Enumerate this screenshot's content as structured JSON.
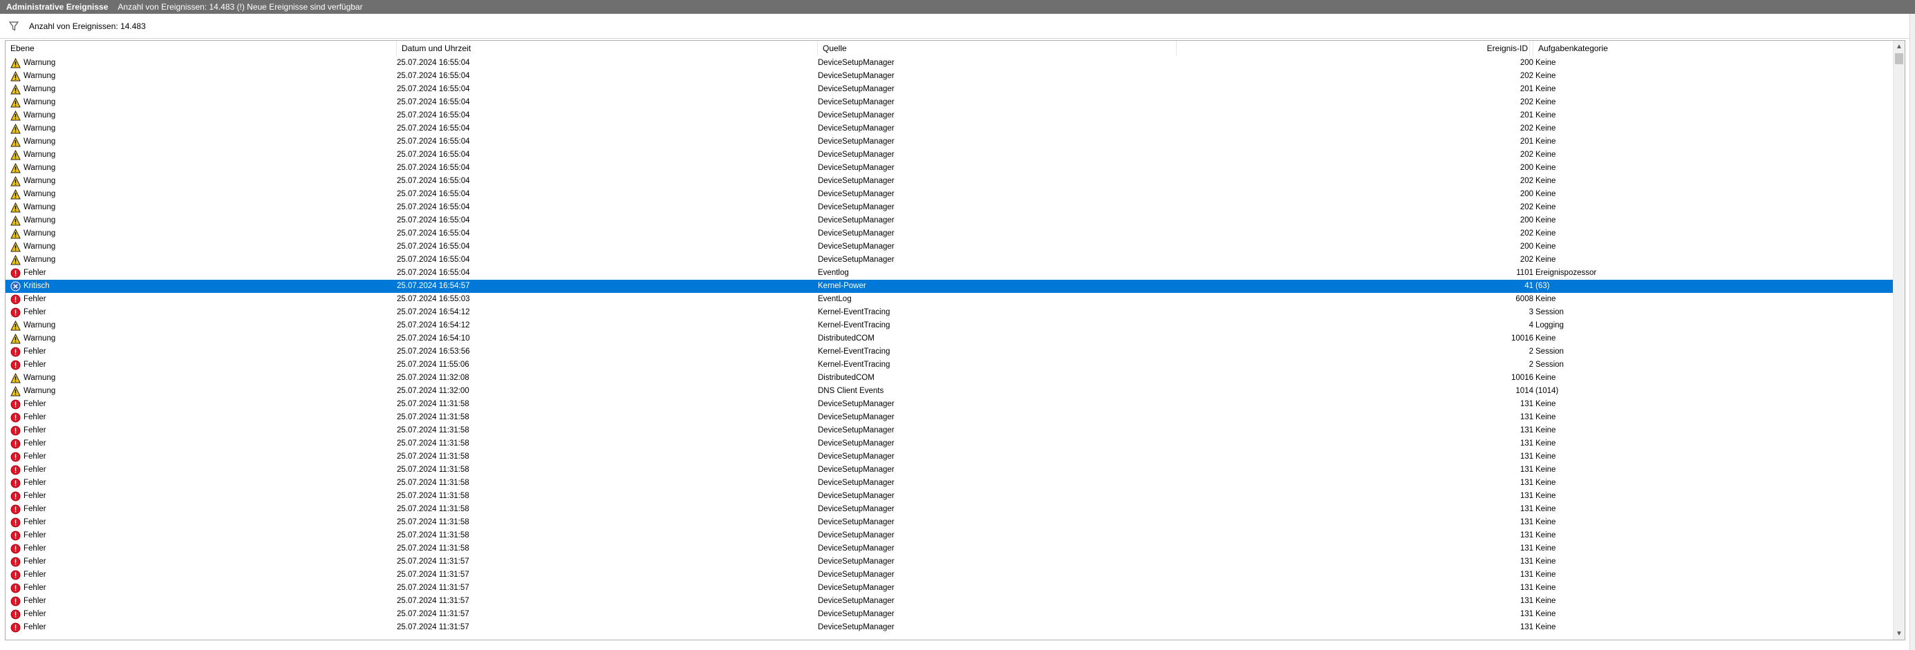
{
  "title_bar": {
    "name": "Administrative Ereignisse",
    "info": "Anzahl von Ereignissen: 14.483 (!) Neue Ereignisse sind verfügbar"
  },
  "filter_bar": {
    "count_text": "Anzahl von Ereignissen: 14.483",
    "icon": "filter-icon"
  },
  "table": {
    "columns": {
      "level": "Ebene",
      "date": "Datum und Uhrzeit",
      "source": "Quelle",
      "event_id": "Ereignis-ID",
      "task_category": "Aufgabenkategorie"
    },
    "rows": [
      {
        "level": "Warnung",
        "date": "25.07.2024 16:55:04",
        "source": "DeviceSetupManager",
        "event_id": "200",
        "task_category": "Keine",
        "icon": "warning-icon"
      },
      {
        "level": "Warnung",
        "date": "25.07.2024 16:55:04",
        "source": "DeviceSetupManager",
        "event_id": "202",
        "task_category": "Keine",
        "icon": "warning-icon"
      },
      {
        "level": "Warnung",
        "date": "25.07.2024 16:55:04",
        "source": "DeviceSetupManager",
        "event_id": "201",
        "task_category": "Keine",
        "icon": "warning-icon"
      },
      {
        "level": "Warnung",
        "date": "25.07.2024 16:55:04",
        "source": "DeviceSetupManager",
        "event_id": "202",
        "task_category": "Keine",
        "icon": "warning-icon"
      },
      {
        "level": "Warnung",
        "date": "25.07.2024 16:55:04",
        "source": "DeviceSetupManager",
        "event_id": "201",
        "task_category": "Keine",
        "icon": "warning-icon"
      },
      {
        "level": "Warnung",
        "date": "25.07.2024 16:55:04",
        "source": "DeviceSetupManager",
        "event_id": "202",
        "task_category": "Keine",
        "icon": "warning-icon"
      },
      {
        "level": "Warnung",
        "date": "25.07.2024 16:55:04",
        "source": "DeviceSetupManager",
        "event_id": "201",
        "task_category": "Keine",
        "icon": "warning-icon"
      },
      {
        "level": "Warnung",
        "date": "25.07.2024 16:55:04",
        "source": "DeviceSetupManager",
        "event_id": "202",
        "task_category": "Keine",
        "icon": "warning-icon"
      },
      {
        "level": "Warnung",
        "date": "25.07.2024 16:55:04",
        "source": "DeviceSetupManager",
        "event_id": "200",
        "task_category": "Keine",
        "icon": "warning-icon"
      },
      {
        "level": "Warnung",
        "date": "25.07.2024 16:55:04",
        "source": "DeviceSetupManager",
        "event_id": "202",
        "task_category": "Keine",
        "icon": "warning-icon"
      },
      {
        "level": "Warnung",
        "date": "25.07.2024 16:55:04",
        "source": "DeviceSetupManager",
        "event_id": "200",
        "task_category": "Keine",
        "icon": "warning-icon"
      },
      {
        "level": "Warnung",
        "date": "25.07.2024 16:55:04",
        "source": "DeviceSetupManager",
        "event_id": "202",
        "task_category": "Keine",
        "icon": "warning-icon"
      },
      {
        "level": "Warnung",
        "date": "25.07.2024 16:55:04",
        "source": "DeviceSetupManager",
        "event_id": "200",
        "task_category": "Keine",
        "icon": "warning-icon"
      },
      {
        "level": "Warnung",
        "date": "25.07.2024 16:55:04",
        "source": "DeviceSetupManager",
        "event_id": "202",
        "task_category": "Keine",
        "icon": "warning-icon"
      },
      {
        "level": "Warnung",
        "date": "25.07.2024 16:55:04",
        "source": "DeviceSetupManager",
        "event_id": "200",
        "task_category": "Keine",
        "icon": "warning-icon"
      },
      {
        "level": "Warnung",
        "date": "25.07.2024 16:55:04",
        "source": "DeviceSetupManager",
        "event_id": "202",
        "task_category": "Keine",
        "icon": "warning-icon"
      },
      {
        "level": "Fehler",
        "date": "25.07.2024 16:55:04",
        "source": "Eventlog",
        "event_id": "1101",
        "task_category": "Ereignispozessor",
        "icon": "error-icon"
      },
      {
        "level": "Kritisch",
        "date": "25.07.2024 16:54:57",
        "source": "Kernel-Power",
        "event_id": "41",
        "task_category": "(63)",
        "icon": "critical-icon",
        "selected": true
      },
      {
        "level": "Fehler",
        "date": "25.07.2024 16:55:03",
        "source": "EventLog",
        "event_id": "6008",
        "task_category": "Keine",
        "icon": "error-icon"
      },
      {
        "level": "Fehler",
        "date": "25.07.2024 16:54:12",
        "source": "Kernel-EventTracing",
        "event_id": "3",
        "task_category": "Session",
        "icon": "error-icon"
      },
      {
        "level": "Warnung",
        "date": "25.07.2024 16:54:12",
        "source": "Kernel-EventTracing",
        "event_id": "4",
        "task_category": "Logging",
        "icon": "warning-icon"
      },
      {
        "level": "Warnung",
        "date": "25.07.2024 16:54:10",
        "source": "DistributedCOM",
        "event_id": "10016",
        "task_category": "Keine",
        "icon": "warning-icon"
      },
      {
        "level": "Fehler",
        "date": "25.07.2024 16:53:56",
        "source": "Kernel-EventTracing",
        "event_id": "2",
        "task_category": "Session",
        "icon": "error-icon"
      },
      {
        "level": "Fehler",
        "date": "25.07.2024 11:55:06",
        "source": "Kernel-EventTracing",
        "event_id": "2",
        "task_category": "Session",
        "icon": "error-icon"
      },
      {
        "level": "Warnung",
        "date": "25.07.2024 11:32:08",
        "source": "DistributedCOM",
        "event_id": "10016",
        "task_category": "Keine",
        "icon": "warning-icon"
      },
      {
        "level": "Warnung",
        "date": "25.07.2024 11:32:00",
        "source": "DNS Client Events",
        "event_id": "1014",
        "task_category": "(1014)",
        "icon": "warning-icon"
      },
      {
        "level": "Fehler",
        "date": "25.07.2024 11:31:58",
        "source": "DeviceSetupManager",
        "event_id": "131",
        "task_category": "Keine",
        "icon": "error-icon"
      },
      {
        "level": "Fehler",
        "date": "25.07.2024 11:31:58",
        "source": "DeviceSetupManager",
        "event_id": "131",
        "task_category": "Keine",
        "icon": "error-icon"
      },
      {
        "level": "Fehler",
        "date": "25.07.2024 11:31:58",
        "source": "DeviceSetupManager",
        "event_id": "131",
        "task_category": "Keine",
        "icon": "error-icon"
      },
      {
        "level": "Fehler",
        "date": "25.07.2024 11:31:58",
        "source": "DeviceSetupManager",
        "event_id": "131",
        "task_category": "Keine",
        "icon": "error-icon"
      },
      {
        "level": "Fehler",
        "date": "25.07.2024 11:31:58",
        "source": "DeviceSetupManager",
        "event_id": "131",
        "task_category": "Keine",
        "icon": "error-icon"
      },
      {
        "level": "Fehler",
        "date": "25.07.2024 11:31:58",
        "source": "DeviceSetupManager",
        "event_id": "131",
        "task_category": "Keine",
        "icon": "error-icon"
      },
      {
        "level": "Fehler",
        "date": "25.07.2024 11:31:58",
        "source": "DeviceSetupManager",
        "event_id": "131",
        "task_category": "Keine",
        "icon": "error-icon"
      },
      {
        "level": "Fehler",
        "date": "25.07.2024 11:31:58",
        "source": "DeviceSetupManager",
        "event_id": "131",
        "task_category": "Keine",
        "icon": "error-icon"
      },
      {
        "level": "Fehler",
        "date": "25.07.2024 11:31:58",
        "source": "DeviceSetupManager",
        "event_id": "131",
        "task_category": "Keine",
        "icon": "error-icon"
      },
      {
        "level": "Fehler",
        "date": "25.07.2024 11:31:58",
        "source": "DeviceSetupManager",
        "event_id": "131",
        "task_category": "Keine",
        "icon": "error-icon"
      },
      {
        "level": "Fehler",
        "date": "25.07.2024 11:31:58",
        "source": "DeviceSetupManager",
        "event_id": "131",
        "task_category": "Keine",
        "icon": "error-icon"
      },
      {
        "level": "Fehler",
        "date": "25.07.2024 11:31:58",
        "source": "DeviceSetupManager",
        "event_id": "131",
        "task_category": "Keine",
        "icon": "error-icon"
      },
      {
        "level": "Fehler",
        "date": "25.07.2024 11:31:57",
        "source": "DeviceSetupManager",
        "event_id": "131",
        "task_category": "Keine",
        "icon": "error-icon"
      },
      {
        "level": "Fehler",
        "date": "25.07.2024 11:31:57",
        "source": "DeviceSetupManager",
        "event_id": "131",
        "task_category": "Keine",
        "icon": "error-icon"
      },
      {
        "level": "Fehler",
        "date": "25.07.2024 11:31:57",
        "source": "DeviceSetupManager",
        "event_id": "131",
        "task_category": "Keine",
        "icon": "error-icon"
      },
      {
        "level": "Fehler",
        "date": "25.07.2024 11:31:57",
        "source": "DeviceSetupManager",
        "event_id": "131",
        "task_category": "Keine",
        "icon": "error-icon"
      },
      {
        "level": "Fehler",
        "date": "25.07.2024 11:31:57",
        "source": "DeviceSetupManager",
        "event_id": "131",
        "task_category": "Keine",
        "icon": "error-icon"
      },
      {
        "level": "Fehler",
        "date": "25.07.2024 11:31:57",
        "source": "DeviceSetupManager",
        "event_id": "131",
        "task_category": "Keine",
        "icon": "error-icon"
      }
    ]
  },
  "colors": {
    "title_bg": "#6f6f6f",
    "selection": "#0078d7",
    "warning": "#f5c400",
    "error": "#e81123",
    "critical": "#2b63c6"
  }
}
